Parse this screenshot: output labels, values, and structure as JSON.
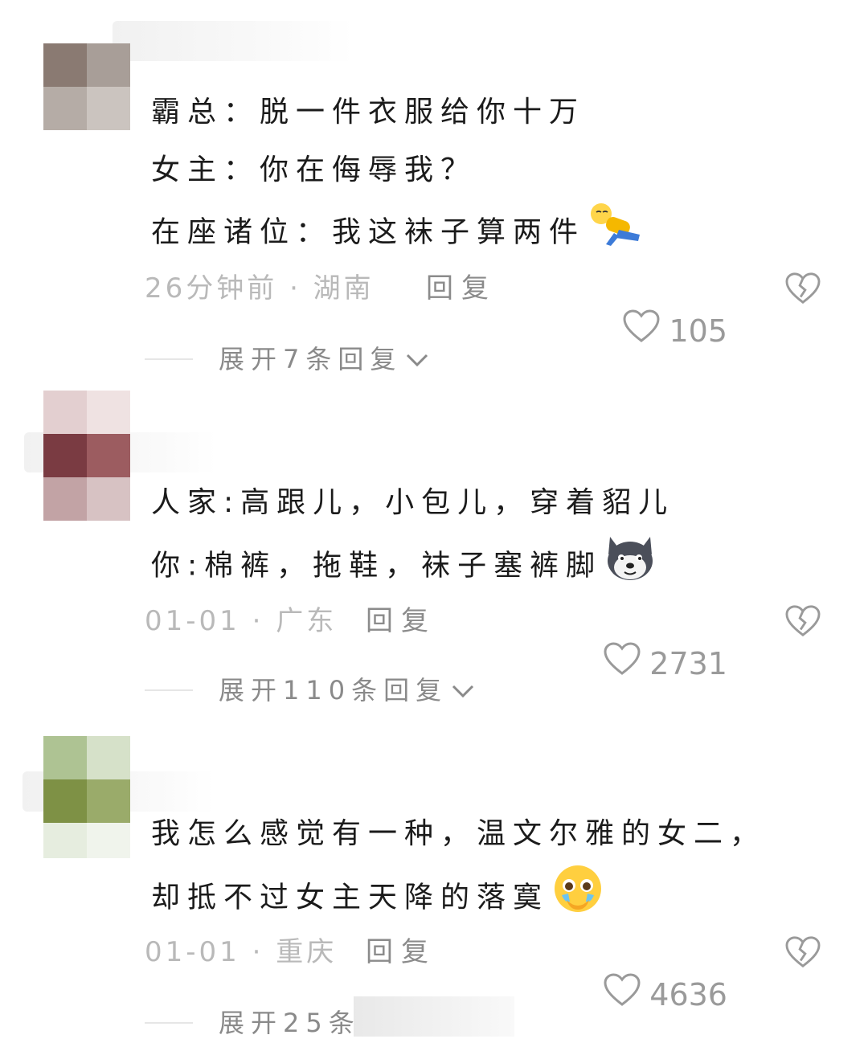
{
  "comments": [
    {
      "lines": [
        "霸总：脱一件衣服给你十万",
        "女主：你在侮辱我？",
        "在座诸位：我这袜子算两件"
      ],
      "emoji": "lying-down-emoji",
      "time": "26分钟前 · 湖南",
      "reply": "回复",
      "likes": "105",
      "expand": "展开7条回复",
      "avatar_colors": [
        "#8a7a72",
        "#a89e98",
        "#b5aca6",
        "#cbc4bf"
      ]
    },
    {
      "lines": [
        "人家:高跟儿，小包儿，穿着貂儿",
        "你:棉裤，拖鞋，袜子塞裤脚"
      ],
      "emoji": "husky-dog-emoji",
      "time": "01-01 · 广东",
      "reply": "回复",
      "likes": "2731",
      "expand": "展开110条回复",
      "avatar_colors": [
        "#7a3b42",
        "#9c5c60",
        "#c2a3a5",
        "#d7c2c3"
      ]
    },
    {
      "lines": [
        "我怎么感觉有一种，温文尔雅的女二，",
        "却抵不过女主天降的落寞"
      ],
      "emoji": "pleading-face-emoji",
      "time": "01-01 · 重庆",
      "reply": "回复",
      "likes": "4636",
      "expand": "展开25条",
      "avatar_colors": [
        "#aec393",
        "#d6e1c9",
        "#7e9145",
        "#9aab6a"
      ]
    }
  ],
  "colors": {
    "text": "#1b1b1b",
    "meta": "#b9b9b9",
    "icon": "#9a9a9a"
  }
}
